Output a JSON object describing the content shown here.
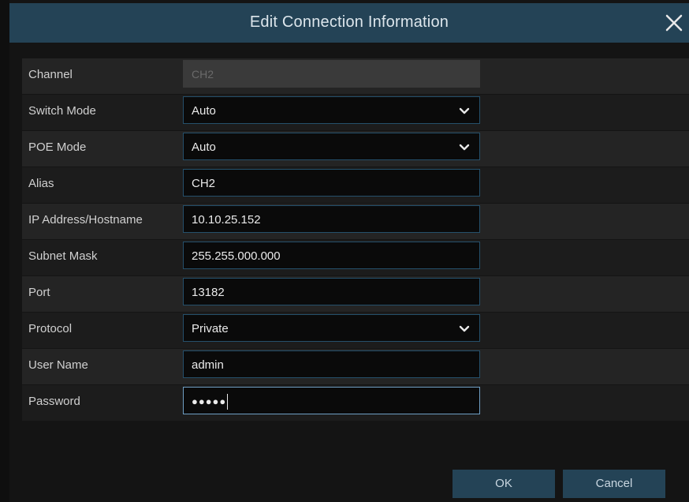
{
  "dialog": {
    "title": "Edit Connection Information"
  },
  "fields": {
    "channel": {
      "label": "Channel",
      "value": "CH2"
    },
    "switch_mode": {
      "label": "Switch Mode",
      "value": "Auto"
    },
    "poe_mode": {
      "label": "POE Mode",
      "value": "Auto"
    },
    "alias": {
      "label": "Alias",
      "value": "CH2"
    },
    "ip": {
      "label": "IP Address/Hostname",
      "value": "10.10.25.152"
    },
    "subnet": {
      "label": "Subnet Mask",
      "value": "255.255.000.000"
    },
    "port": {
      "label": "Port",
      "value": "13182"
    },
    "protocol": {
      "label": "Protocol",
      "value": "Private"
    },
    "username": {
      "label": "User Name",
      "value": "admin"
    },
    "password": {
      "label": "Password",
      "value": "●●●●●"
    }
  },
  "buttons": {
    "ok": "OK",
    "cancel": "Cancel"
  },
  "icons": {
    "close": "close-icon",
    "dropdown": "chevron-down-icon"
  },
  "colors": {
    "titlebar": "#244356",
    "field_border": "#25506b",
    "focused_border": "#6f9fc4"
  }
}
